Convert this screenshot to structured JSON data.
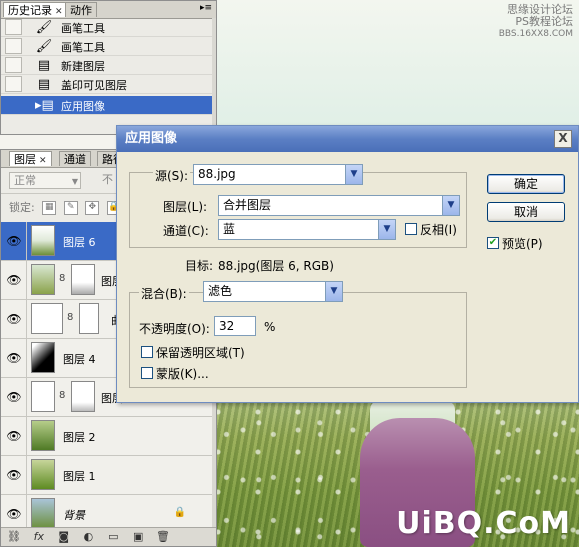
{
  "watermark": {
    "top_line1": "思缘设计论坛",
    "top_line2": "PS教程论坛",
    "top_line3": "BBS.16XX8.COM",
    "bottom": "UiBQ.CoM"
  },
  "history_panel": {
    "tabs": [
      "历史记录",
      "动作"
    ],
    "items": [
      {
        "label": "画笔工具",
        "icon": "brush-icon"
      },
      {
        "label": "画笔工具",
        "icon": "brush-icon"
      },
      {
        "label": "新建图层",
        "icon": "document-icon"
      },
      {
        "label": "盖印可见图层",
        "icon": "document-icon"
      },
      {
        "label": "应用图像",
        "icon": "document-icon",
        "selected": true
      }
    ]
  },
  "layers_panel": {
    "tabs": [
      "图层",
      "通道",
      "路径"
    ],
    "blend_mode": "正常",
    "opacity_label": "不",
    "lock_label": "锁定:",
    "layers": [
      {
        "name": "图层 6",
        "selected": true
      },
      {
        "name": "图层",
        "mask": true
      },
      {
        "name": "曲",
        "mask": true,
        "adjustment": true
      },
      {
        "name": "图层 4"
      },
      {
        "name": "图层",
        "mask": true
      },
      {
        "name": "图层 2"
      },
      {
        "name": "图层 1"
      },
      {
        "name": "背景",
        "locked": true
      }
    ],
    "footer_icons": [
      "link-icon",
      "fx-icon",
      "mask-icon",
      "adjustment-icon",
      "folder-icon",
      "new-layer-icon",
      "trash-icon"
    ]
  },
  "dialog": {
    "title": "应用图像",
    "close": "X",
    "source_label": "源(S):",
    "source_value": "88.jpg",
    "layer_label": "图层(L):",
    "layer_value": "合并图层",
    "channel_label": "通道(C):",
    "channel_value": "蓝",
    "invert_label": "反相(I)",
    "target_label": "目标:",
    "target_value": "88.jpg(图层 6, RGB)",
    "blending_label": "混合(B):",
    "blending_value": "滤色",
    "opacity_label": "不透明度(O):",
    "opacity_value": "32",
    "opacity_unit": "%",
    "preserve_label": "保留透明区域(T)",
    "mask_label": "蒙版(K)...",
    "ok": "确定",
    "cancel": "取消",
    "preview_label": "预览(P)",
    "preview_checked": true
  }
}
